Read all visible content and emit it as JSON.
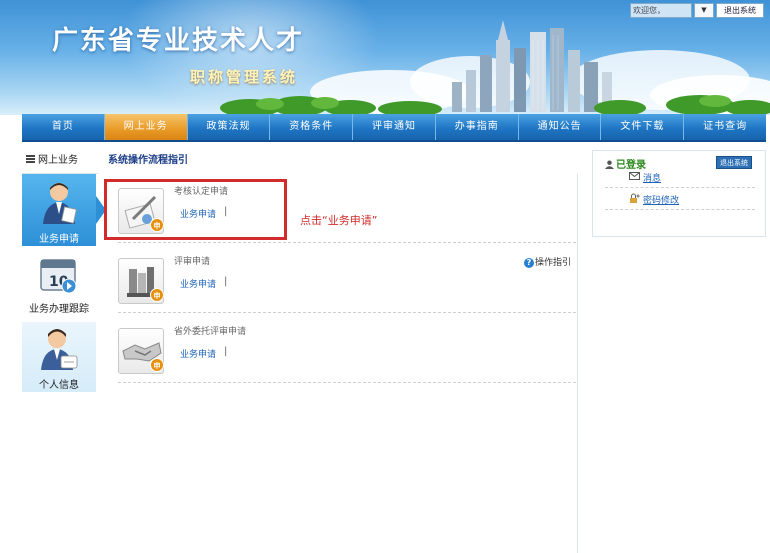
{
  "header": {
    "title": "广东省专业技术人才",
    "subtitle": "职称管理系统",
    "welcome": "欢迎您，",
    "welcome_arrow": "▼",
    "logout": "退出系统"
  },
  "nav": {
    "items": [
      "首页",
      "网上业务",
      "政策法规",
      "资格条件",
      "评审通知",
      "办事指南",
      "通知公告",
      "文件下载",
      "证书查询"
    ],
    "active_index": 1
  },
  "sidebar": {
    "heading": "网上业务",
    "items": [
      {
        "label": "业务申请",
        "icon": "applicant-person-icon",
        "active": true
      },
      {
        "label": "业务办理跟踪",
        "icon": "calendar-tracking-icon",
        "active": false
      },
      {
        "label": "个人信息",
        "icon": "user-profile-icon",
        "active": false
      }
    ]
  },
  "main": {
    "breadcrumb": "系统操作流程指引",
    "guide_label": "操作指引",
    "guide_icon": "question-icon",
    "businesses": [
      {
        "name": "考核认定申请",
        "apply_label": "业务申请",
        "separator": "|",
        "icon": "certificate-pen-icon",
        "badge": "申"
      },
      {
        "name": "评审申请",
        "apply_label": "业务申请",
        "separator": "|",
        "icon": "documents-stack-icon",
        "badge": "申"
      },
      {
        "name": "省外委托评审申请",
        "apply_label": "业务申请",
        "separator": "|",
        "icon": "handshake-icon",
        "badge": "申"
      }
    ],
    "annotation": "点击“业务申请”"
  },
  "account": {
    "status": "已登录",
    "logout": "退出系统",
    "message_link": "消息",
    "password_link": "密码修改"
  },
  "colors": {
    "nav_blue": "#1f76c4",
    "nav_active": "#e99a26",
    "annotation_red": "#d12b2b",
    "link_blue": "#1d63b7",
    "status_green": "#2c8a1e"
  }
}
